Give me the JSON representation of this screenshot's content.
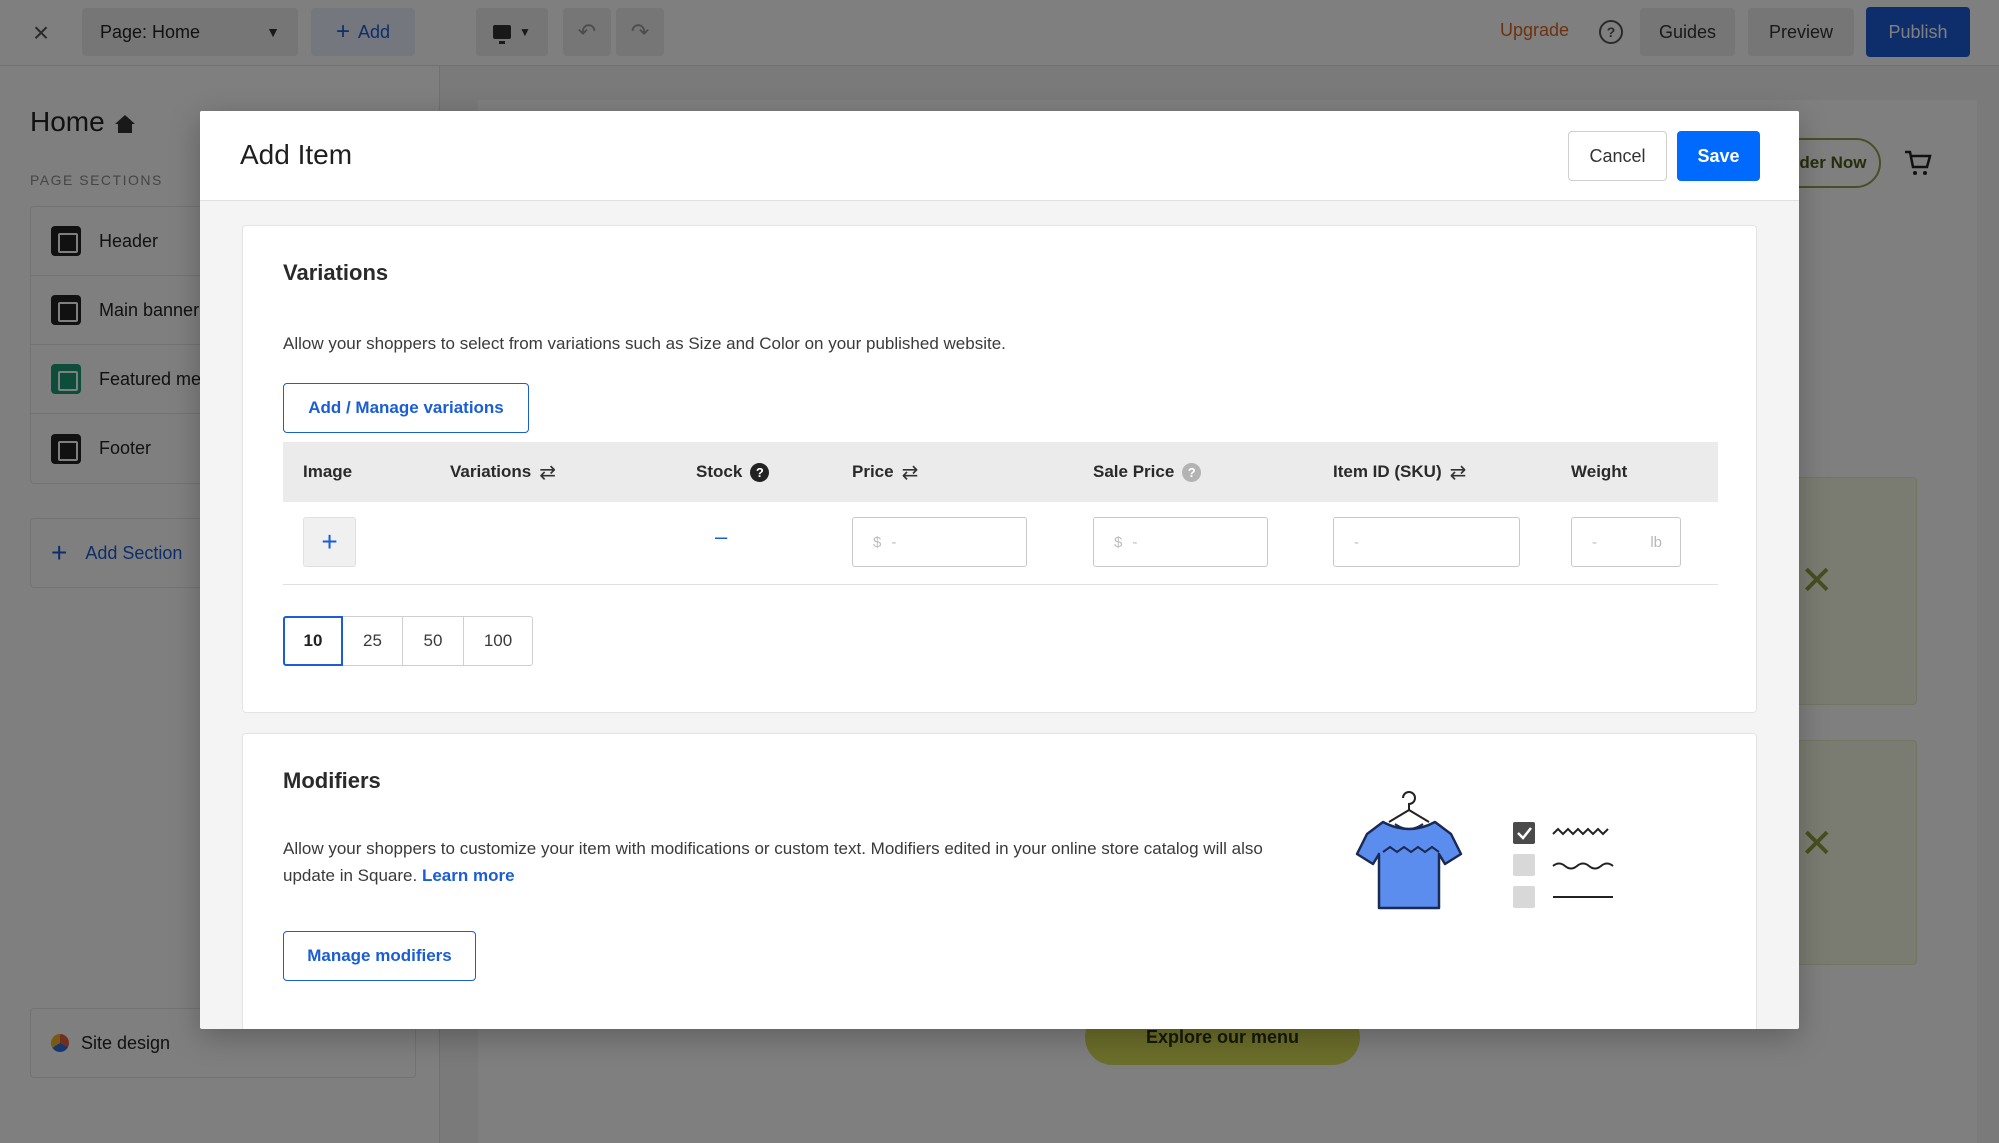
{
  "topbar": {
    "page_selector": "Page: Home",
    "add_label": "Add",
    "upgrade_label": "Upgrade",
    "guides_label": "Guides",
    "preview_label": "Preview",
    "publish_label": "Publish"
  },
  "sidebar": {
    "title": "Home",
    "section_label": "PAGE SECTIONS",
    "items": [
      {
        "label": "Header",
        "icon": "header-icon"
      },
      {
        "label": "Main banner",
        "icon": "banner-icon"
      },
      {
        "label": "Featured menu",
        "icon": "featured-icon"
      },
      {
        "label": "Footer",
        "icon": "footer-icon"
      }
    ],
    "add_section_label": "Add Section",
    "site_design_label": "Site design"
  },
  "canvas": {
    "order_button_label": "Order Now",
    "explore_button_label": "Explore our menu"
  },
  "modal": {
    "title": "Add Item",
    "cancel_label": "Cancel",
    "save_label": "Save",
    "variations": {
      "title": "Variations",
      "description": "Allow your shoppers to select from variations such as Size and Color on your published website.",
      "manage_button": "Add / Manage variations",
      "columns": [
        "Image",
        "Variations",
        "Stock",
        "Price",
        "Sale Price",
        "Item ID (SKU)",
        "Weight"
      ],
      "row": {
        "stock": "–",
        "price_prefix": "$",
        "price_placeholder": "-",
        "sale_price_prefix": "$",
        "sale_price_placeholder": "-",
        "sku_placeholder": "-",
        "weight_placeholder": "-",
        "weight_unit": "lb"
      },
      "page_sizes": [
        "10",
        "25",
        "50",
        "100"
      ],
      "selected_page_size": "10"
    },
    "modifiers": {
      "title": "Modifiers",
      "description": "Allow your shoppers to customize your item with modifications or custom text. Modifiers edited in your online store catalog will also update in Square.",
      "learn_more": "Learn more",
      "manage_button": "Manage modifiers"
    }
  },
  "colors": {
    "primary": "#006aff",
    "link": "#1a5dd6",
    "upgrade": "#d8651a",
    "illustration_shirt": "#5b8def"
  }
}
